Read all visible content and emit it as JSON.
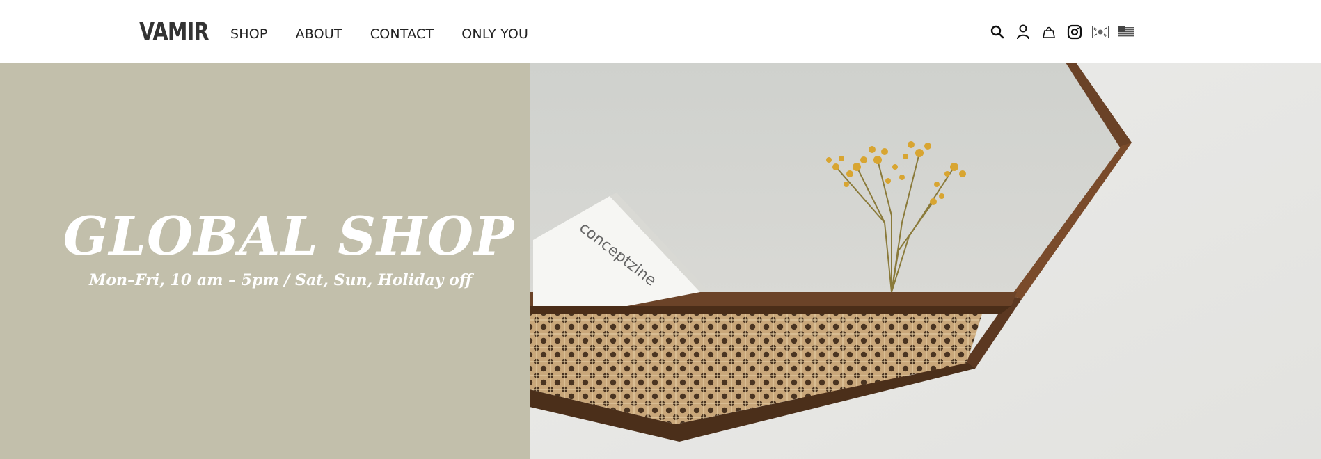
{
  "header": {
    "logo": "VAMIR",
    "nav": [
      {
        "label": "SHOP"
      },
      {
        "label": "ABOUT"
      },
      {
        "label": "CONTACT"
      },
      {
        "label": "ONLY YOU"
      }
    ],
    "icons": [
      "search-icon",
      "user-icon",
      "shopping-bag-icon",
      "instagram-icon",
      "korea-flag-icon",
      "us-flag-icon"
    ]
  },
  "hero": {
    "title": "GLOBAL SHOP",
    "subtitle": "Mon–Fri, 10 am – 5pm / Sat, Sun, Holiday off",
    "panel_color": "#c2bfab",
    "book_text": "conceptzine"
  }
}
